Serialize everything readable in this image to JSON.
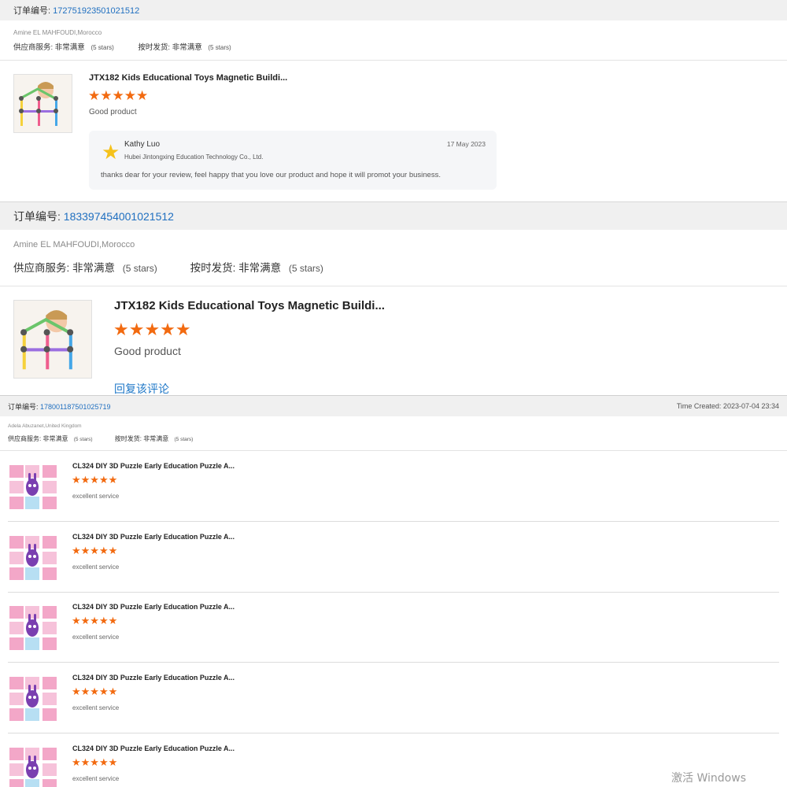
{
  "colors": {
    "accent_blue": "#1f6fc0",
    "star_orange": "#f26a10",
    "header_bg": "#f0f0f0"
  },
  "icons": {
    "star": "star-icon",
    "avatar": "star-avatar-icon"
  },
  "order1": {
    "label": "订单编号:",
    "number": "1727519235010215​12",
    "buyer": "Amine EL MAHFOUDI,Morocco",
    "supplier_service_label": "供应商服务:",
    "supplier_service_value": "非常满意",
    "supplier_service_stars": "(5 stars)",
    "ontime_label": "按时发货:",
    "ontime_value": "非常满意",
    "ontime_stars": "(5 stars)",
    "product_title": "JTX182 Kids Educational Toys Magnetic Buildi...",
    "rating_stars": "★★★★★",
    "comment": "Good product",
    "reply": {
      "name": "Kathy Luo",
      "company": "Hubei Jintongxing Education Technology Co., Ltd.",
      "date": "17 May 2023",
      "text": "thanks dear for your review, feel happy that you love our product and hope it will promot your business."
    }
  },
  "order2": {
    "label": "订单编号:",
    "number": "183397454001021512",
    "buyer": "Amine EL MAHFOUDI,Morocco",
    "supplier_service_label": "供应商服务:",
    "supplier_service_value": "非常满意",
    "supplier_service_stars": "(5 stars)",
    "ontime_label": "按时发货:",
    "ontime_value": "非常满意",
    "ontime_stars": "(5 stars)",
    "product_title": "JTX182 Kids Educational Toys Magnetic Buildi...",
    "rating_stars": "★★★★★",
    "comment": "Good product",
    "reply_link": "回复该评论"
  },
  "order3": {
    "label": "订单编号:",
    "number": "178001187501025719",
    "time_created": "Time Created: 2023-07-04 23:34",
    "buyer": "Adela Abuzanet,United Kingdom",
    "supplier_service_label": "供应商服务:",
    "supplier_service_value": "非常满意",
    "supplier_service_stars": "(5 stars)",
    "ontime_label": "按时发货:",
    "ontime_value": "非常满意",
    "ontime_stars": "(5 stars)",
    "items": [
      {
        "title": "CL324 DIY 3D Puzzle Early Education Puzzle A...",
        "stars": "★★★★★",
        "comment": "excellent service"
      },
      {
        "title": "CL324 DIY 3D Puzzle Early Education Puzzle A...",
        "stars": "★★★★★",
        "comment": "excellent service"
      },
      {
        "title": "CL324 DIY 3D Puzzle Early Education Puzzle A...",
        "stars": "★★★★★",
        "comment": "excellent service"
      },
      {
        "title": "CL324 DIY 3D Puzzle Early Education Puzzle A...",
        "stars": "★★★★★",
        "comment": "excellent service"
      },
      {
        "title": "CL324 DIY 3D Puzzle Early Education Puzzle A...",
        "stars": "★★★★★",
        "comment": "excellent service"
      }
    ]
  },
  "watermark": "激活 Windows"
}
